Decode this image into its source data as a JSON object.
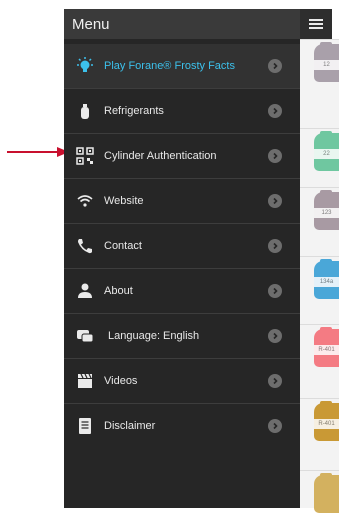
{
  "menu": {
    "title": "Menu",
    "items": [
      {
        "label": "Play Forane® Frosty Facts",
        "icon": "lightbulb-icon",
        "highlight": true
      },
      {
        "label": "Refrigerants",
        "icon": "refrigerant-bottle-icon"
      },
      {
        "label": "Cylinder Authentication",
        "icon": "qr-code-icon"
      },
      {
        "label": "Website",
        "icon": "wifi-icon"
      },
      {
        "label": "Contact",
        "icon": "phone-icon"
      },
      {
        "label": "About",
        "icon": "person-icon"
      },
      {
        "label": "Language: English",
        "icon": "speech-bubble-icon"
      },
      {
        "label": "Videos",
        "icon": "clapperboard-icon"
      },
      {
        "label": "Disclaimer",
        "icon": "document-icon"
      }
    ]
  },
  "background_list": [
    {
      "label": "12",
      "color": "#a9a0aa"
    },
    {
      "label": "22",
      "color": "#6fc7a0"
    },
    {
      "label": "123",
      "color": "#a89aa3"
    },
    {
      "label": "134a",
      "color": "#4aa7d8"
    },
    {
      "label": "R-401",
      "color": "#f47b83"
    },
    {
      "label": "R-401",
      "color": "#c99935"
    },
    {
      "label": "",
      "color": "#d3b15f"
    }
  ],
  "colors": {
    "accent": "#3cc1ec",
    "arrow": "#c8102e",
    "drawer": "#262626"
  }
}
